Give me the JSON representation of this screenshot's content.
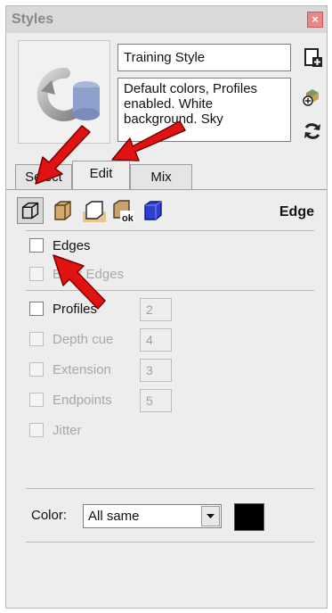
{
  "window": {
    "title": "Styles",
    "close_icon": "close-icon"
  },
  "style_info": {
    "name": "Training Style",
    "description": "Default colors, Profiles enabled. White background. Sky"
  },
  "side_icons": [
    "create-style-icon",
    "update-style-icon",
    "refresh-icon"
  ],
  "tabs": [
    {
      "label": "Select"
    },
    {
      "label": "Edit",
      "active": true
    },
    {
      "label": "Mix"
    }
  ],
  "toolbar": {
    "section_title": "Edge",
    "icons": [
      "edge-settings-icon",
      "face-settings-icon",
      "background-settings-icon",
      "watermark-settings-icon",
      "modeling-settings-icon"
    ]
  },
  "edge_settings": [
    {
      "label": "Edges",
      "checked": false,
      "enabled": true
    },
    {
      "label": "Back Edges",
      "checked": false,
      "enabled": false
    },
    {
      "label": "Profiles",
      "checked": false,
      "enabled": true,
      "value": "2"
    },
    {
      "label": "Depth cue",
      "checked": false,
      "enabled": false,
      "value": "4"
    },
    {
      "label": "Extension",
      "checked": false,
      "enabled": false,
      "value": "3"
    },
    {
      "label": "Endpoints",
      "checked": false,
      "enabled": false,
      "value": "5"
    },
    {
      "label": "Jitter",
      "checked": false,
      "enabled": false
    }
  ],
  "color": {
    "label": "Color:",
    "selected": "All same",
    "swatch": "#000000"
  },
  "colors": {
    "arrow": "#e11212",
    "panel": "#ededed"
  }
}
